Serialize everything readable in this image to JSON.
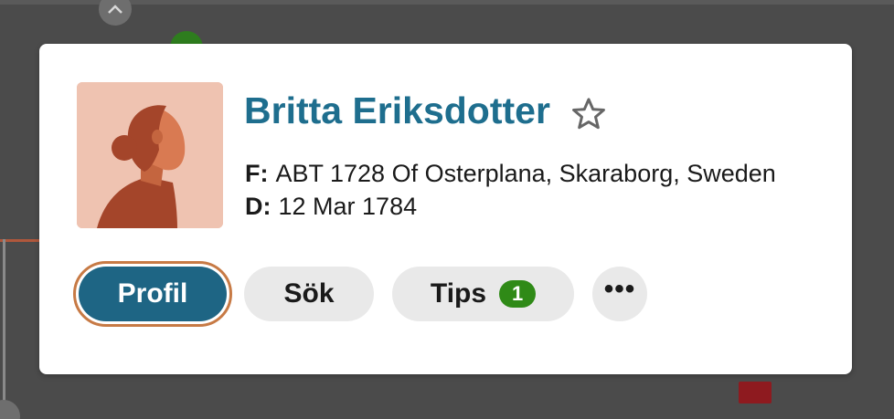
{
  "background": {
    "collapse_icon": "chevron-up-icon",
    "bottom_icon": "chevron-down-icon"
  },
  "card": {
    "person": {
      "name": "Britta Eriksdotter",
      "favorite_icon": "star-outline-icon"
    },
    "facts": [
      {
        "key": "F:",
        "value": "ABT 1728 Of Osterplana, Skaraborg, Sweden"
      },
      {
        "key": "D:",
        "value": "12 Mar 1784"
      }
    ],
    "actions": {
      "profil_label": "Profil",
      "sok_label": "Sök",
      "tips_label": "Tips",
      "tips_count": "1",
      "more_label": "•••"
    }
  },
  "colors": {
    "name": "#1e6e8e",
    "primary_button": "#1e6584",
    "focus_ring": "#c77a45",
    "secondary_button": "#e9e9e9",
    "badge": "#2f8a17",
    "avatar_bg": "#efc3b1"
  }
}
